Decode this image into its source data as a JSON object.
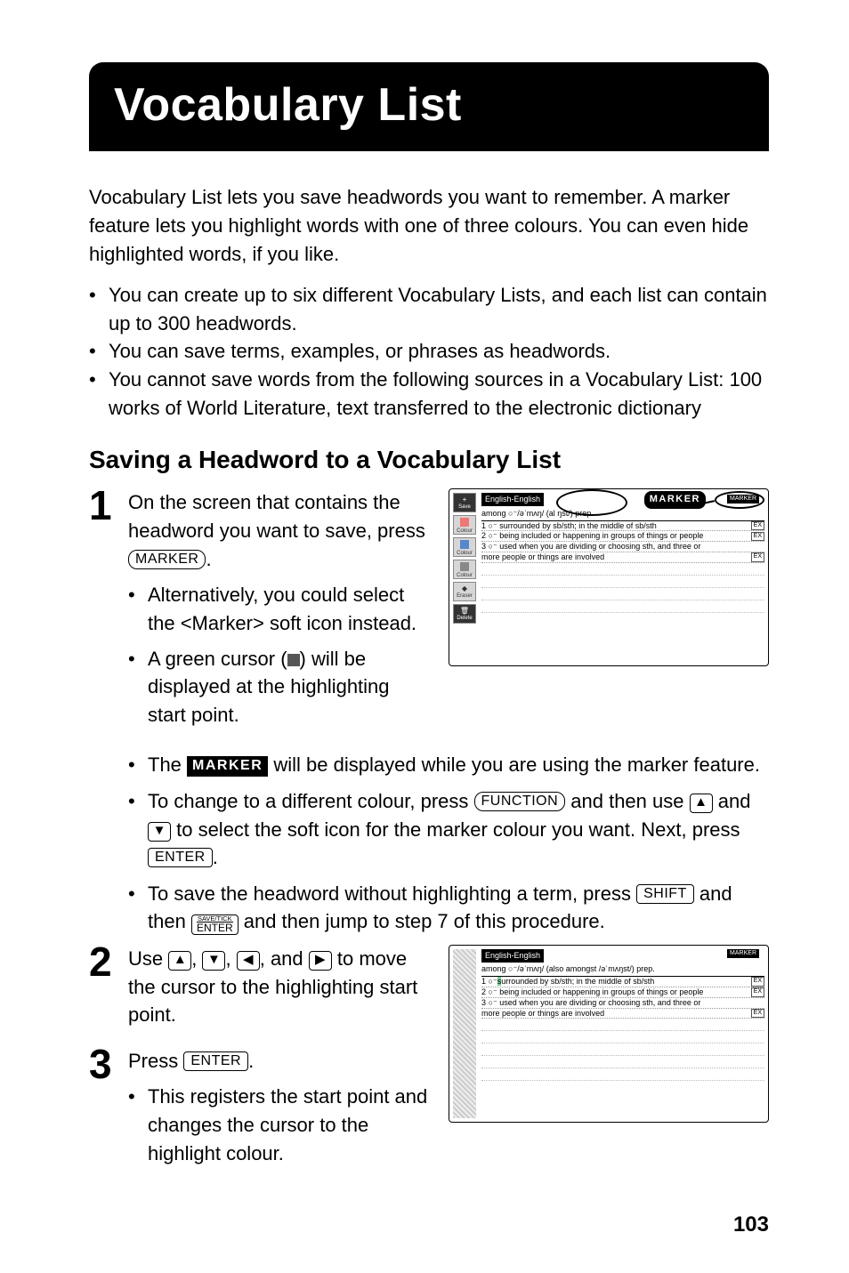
{
  "title": "Vocabulary List",
  "intro": "Vocabulary List lets you save headwords you want to remember. A marker feature lets you highlight words with one of three colours. You can even hide highlighted words, if you like.",
  "intro_bullets": [
    "You can create up to six different Vocabulary Lists, and each list can contain up to 300 headwords.",
    "You can save terms, examples, or phrases as headwords.",
    "You cannot save words from the following sources in a Vocabulary List: 100 works of World Literature, text transferred to the electronic dictionary"
  ],
  "section_heading": "Saving a Headword to a Vocabulary List",
  "steps": {
    "s1": {
      "num": "1",
      "text_a": "On the screen that contains the headword you want to save, press ",
      "key1": "MARKER",
      "text_b": ".",
      "sub": [
        "Alternatively, you could select the <Marker> soft icon instead.",
        "__CURSOR__"
      ],
      "cursor_a": "A green cursor (",
      "cursor_b": ") will be displayed at the highlighting start point.",
      "full_sub": {
        "b1_a": "The ",
        "b1_inv": "MARKER",
        "b1_b": " will be displayed while you are using the marker feature.",
        "b2_a": "To change to a different colour, press ",
        "b2_key1": "FUNCTION",
        "b2_b": " and then use ",
        "b2_c": " and ",
        "b2_d": " to select the soft icon for the marker colour you want. Next, press ",
        "b2_key2": "ENTER",
        "b2_e": ".",
        "b3_a": "To save the headword without highlighting a term, press ",
        "b3_key1": "SHIFT",
        "b3_b": " and then ",
        "b3_stack_top": "SAVE/TICK",
        "b3_stack_bot": "ENTER",
        "b3_c": " and then jump to step 7 of this procedure."
      }
    },
    "s2": {
      "num": "2",
      "text_a": "Use ",
      "text_mid": ", ",
      "text_and": ", and ",
      "text_b": " to move the cursor to the highlighting start point."
    },
    "s3": {
      "num": "3",
      "text_a": "Press ",
      "key1": "ENTER",
      "text_b": ".",
      "sub1": "This registers the start point and changes the cursor to the highlight colour."
    }
  },
  "screenshots": {
    "a": {
      "header": "English-English",
      "marker_badge": "MARKER",
      "marker_small": "MARKER",
      "entry_head": "among ○⁻/əˈmʌŋ/ (al                       ŋst/) prep.",
      "defs": [
        "1 ○⁻ surrounded by sb/sth; in the middle of sb/sth",
        "2 ○⁻ being included or happening in groups of things or people",
        "3 ○⁻ used when you are dividing or choosing sth, and three or",
        "   more people or things are involved"
      ],
      "ex": "EX",
      "side": [
        {
          "lbl": "Save",
          "dark": true
        },
        {
          "lbl": "Colour"
        },
        {
          "lbl": "Colour"
        },
        {
          "lbl": "Colour"
        },
        {
          "lbl": "Eraser"
        },
        {
          "lbl": "Delete",
          "dark": true
        }
      ]
    },
    "b": {
      "header": "English-English",
      "marker_small": "MARKER",
      "entry_head": "among ○⁻/əˈmʌŋ/ (also amongst /əˈmʌŋst/) prep.",
      "defs": [
        "1 ○⁻ surrounded by sb/sth; in the middle of sb/sth",
        "2 ○⁻ being included or happening in groups of things or people",
        "3 ○⁻ used when you are dividing or choosing sth, and three or",
        "   more people or things are involved"
      ],
      "highlight_char": "s",
      "ex": "EX"
    }
  },
  "page_number": "103"
}
